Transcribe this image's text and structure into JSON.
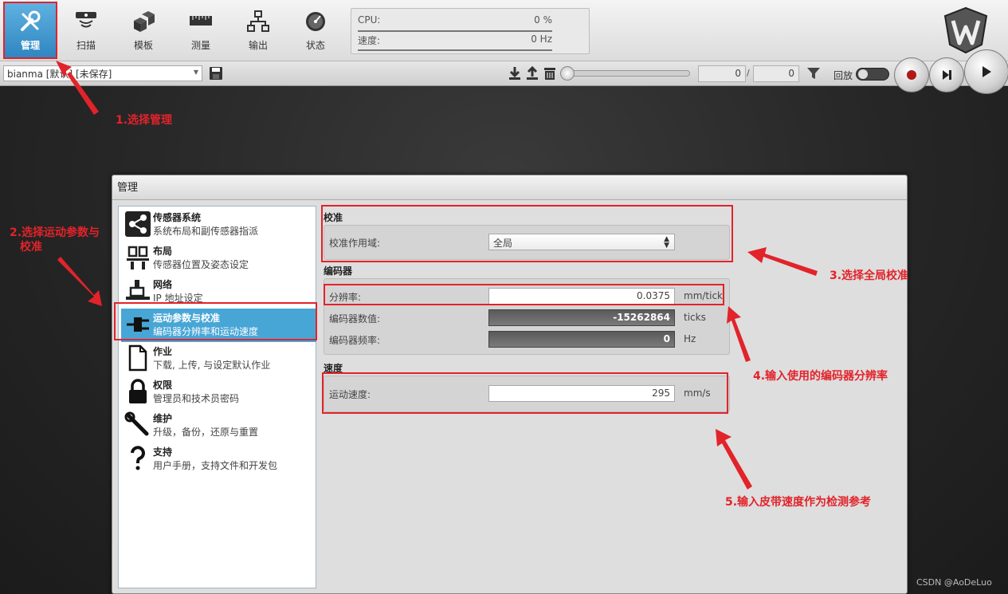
{
  "toolbar": {
    "items": [
      {
        "label": "管理",
        "icon": "tools-icon"
      },
      {
        "label": "扫描",
        "icon": "scanner-icon"
      },
      {
        "label": "模板",
        "icon": "cubes-icon"
      },
      {
        "label": "测量",
        "icon": "ruler-icon"
      },
      {
        "label": "输出",
        "icon": "network-icon"
      },
      {
        "label": "状态",
        "icon": "gauge-icon"
      }
    ],
    "stats": {
      "cpu_label": "CPU:",
      "cpu_value": "0 %",
      "speed_label": "速度:",
      "speed_value": "0 Hz"
    }
  },
  "bar2": {
    "job_name": "bianma [默认] [未保存]",
    "frame_current": "0",
    "frame_total": "0",
    "slash": "/",
    "playback_label": "回放"
  },
  "panel": {
    "title": "管理",
    "sidebar": [
      {
        "title": "传感器系统",
        "desc": "系统布局和副传感器指派"
      },
      {
        "title": "布局",
        "desc": "传感器位置及姿态设定"
      },
      {
        "title": "网络",
        "desc": "IP 地址设定"
      },
      {
        "title": "运动参数与校准",
        "desc": "编码器分辨率和运动速度"
      },
      {
        "title": "作业",
        "desc": "下载, 上传, 与设定默认作业"
      },
      {
        "title": "权限",
        "desc": "管理员和技术员密码"
      },
      {
        "title": "维护",
        "desc": "升级，备份，还原与重置"
      },
      {
        "title": "支持",
        "desc": "用户手册，支持文件和开发包"
      }
    ],
    "calibration": {
      "title": "校准",
      "scope_label": "校准作用域:",
      "scope_value": "全局"
    },
    "encoder": {
      "title": "编码器",
      "resolution_label": "分辨率:",
      "resolution_value": "0.0375",
      "resolution_unit": "mm/tick",
      "count_label": "编码器数值:",
      "count_value": "-15262864",
      "count_unit": "ticks",
      "freq_label": "编码器频率:",
      "freq_value": "0",
      "freq_unit": "Hz"
    },
    "speed": {
      "title": "速度",
      "travel_label": "运动速度:",
      "travel_value": "295",
      "travel_unit": "mm/s"
    }
  },
  "annotations": {
    "step1": "1.选择管理",
    "step2_line1": "2.选择运动参数与",
    "step2_line2": "校准",
    "step3": "3.选择全局校准",
    "step4": "4.输入使用的编码器分辨率",
    "step5": "5.输入皮带速度作为检测参考"
  },
  "watermark": "CSDN @AoDeLuo",
  "colors": {
    "accent": "#48a6d6",
    "annotation": "#e2232a"
  }
}
